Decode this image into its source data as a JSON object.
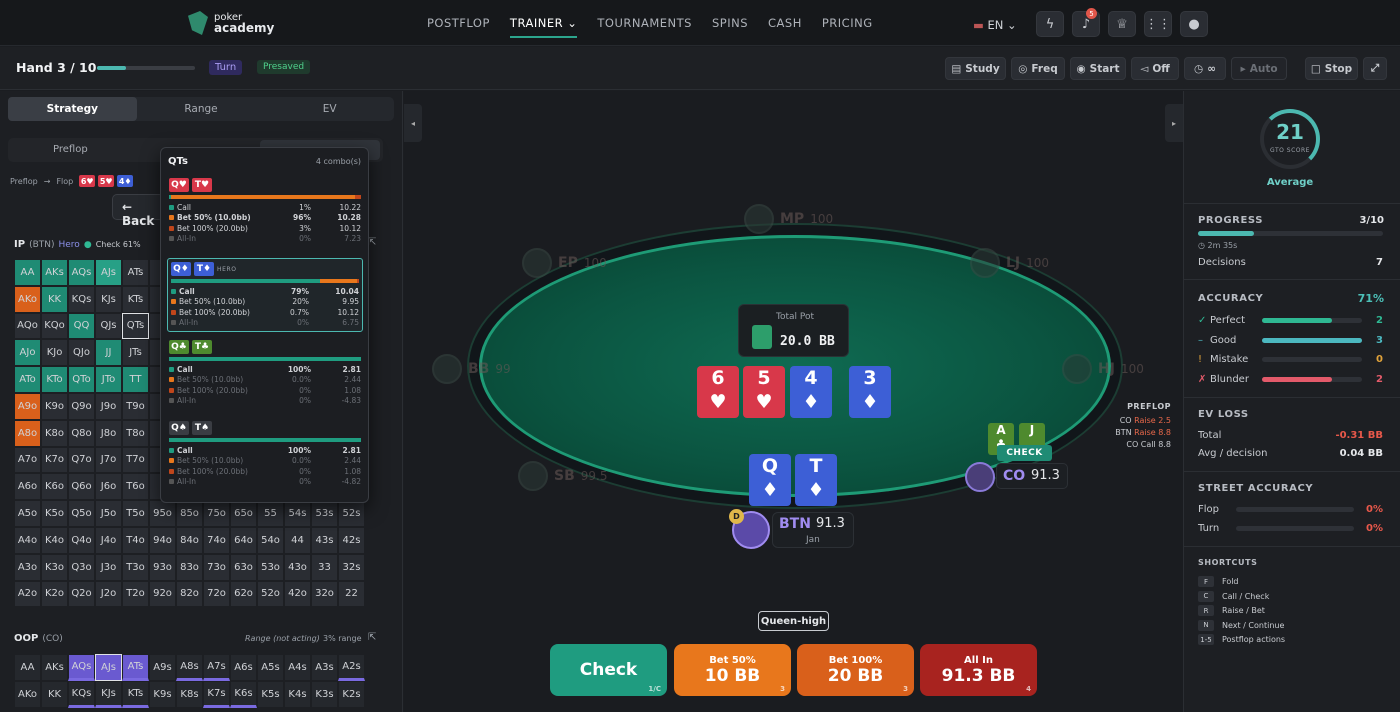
{
  "nav": {
    "brand_line1": "poker",
    "brand_line2": "academy",
    "links": [
      "POSTFLOP",
      "TRAINER",
      "TOURNAMENTS",
      "SPINS",
      "CASH",
      "PRICING"
    ],
    "lang": "EN",
    "notif_count": "5"
  },
  "sub": {
    "hand": "Hand 3 / 10",
    "hand_progress": 0.3,
    "street": "Turn",
    "presaved": "Presaved",
    "buttons": [
      "Study",
      "Freq",
      "Start",
      "Off",
      "∞",
      "Auto",
      "Stop"
    ]
  },
  "left": {
    "tabs": [
      "Strategy",
      "Range",
      "EV"
    ],
    "subtabs": [
      "Preflop"
    ],
    "crumbs": [
      "Preflop",
      "Flop"
    ],
    "back": "← Back",
    "ip": {
      "pos": "IP",
      "paren": "(BTN)",
      "hero": "Hero",
      "check": "Check 61%"
    },
    "oop": {
      "pos": "OOP",
      "paren": "(CO)",
      "note": "Range (not acting)",
      "pct": "3% range"
    },
    "grid": [
      [
        "AA",
        "AKs",
        "AQs",
        "AJs",
        "ATs",
        "",
        "",
        "",
        "",
        "",
        "",
        "",
        ""
      ],
      [
        "AKo",
        "KK",
        "KQs",
        "KJs",
        "KTs",
        "",
        "",
        "",
        "",
        "",
        "",
        "",
        ""
      ],
      [
        "AQo",
        "KQo",
        "QQ",
        "QJs",
        "QTs",
        "",
        "",
        "",
        "",
        "",
        "",
        "",
        ""
      ],
      [
        "AJo",
        "KJo",
        "QJo",
        "JJ",
        "JTs",
        "",
        "",
        "",
        "",
        "",
        "",
        "",
        ""
      ],
      [
        "ATo",
        "KTo",
        "QTo",
        "JTo",
        "TT",
        "",
        "",
        "",
        "",
        "",
        "",
        "",
        ""
      ],
      [
        "A9o",
        "K9o",
        "Q9o",
        "J9o",
        "T9o",
        "",
        "",
        "",
        "",
        "",
        "",
        "",
        ""
      ],
      [
        "A8o",
        "K8o",
        "Q8o",
        "J8o",
        "T8o",
        "",
        "",
        "",
        "",
        "",
        "",
        "",
        ""
      ],
      [
        "A7o",
        "K7o",
        "Q7o",
        "J7o",
        "T7o",
        "",
        "",
        "",
        "",
        "",
        "",
        "",
        ""
      ],
      [
        "A6o",
        "K6o",
        "Q6o",
        "J6o",
        "T6o",
        "",
        "",
        "",
        "",
        "",
        "",
        "",
        ""
      ],
      [
        "A5o",
        "K5o",
        "Q5o",
        "J5o",
        "T5o",
        "95o",
        "85o",
        "75o",
        "65o",
        "55",
        "54s",
        "53s",
        "52s"
      ],
      [
        "A4o",
        "K4o",
        "Q4o",
        "J4o",
        "T4o",
        "94o",
        "84o",
        "74o",
        "64o",
        "54o",
        "44",
        "43s",
        "42s"
      ],
      [
        "A3o",
        "K3o",
        "Q3o",
        "J3o",
        "T3o",
        "93o",
        "83o",
        "73o",
        "63o",
        "53o",
        "43o",
        "33",
        "32s"
      ],
      [
        "A2o",
        "K2o",
        "Q2o",
        "J2o",
        "T2o",
        "92o",
        "82o",
        "72o",
        "62o",
        "52o",
        "42o",
        "32o",
        "22"
      ]
    ],
    "oopgrid": [
      [
        "AA",
        "AKs",
        "AQs",
        "AJs",
        "ATs",
        "A9s",
        "A8s",
        "A7s",
        "A6s",
        "A5s",
        "A4s",
        "A3s",
        "A2s"
      ],
      [
        "AKo",
        "KK",
        "KQs",
        "KJs",
        "KTs",
        "K9s",
        "K8s",
        "K7s",
        "K6s",
        "K5s",
        "K4s",
        "K3s",
        "K2s"
      ]
    ]
  },
  "popup": {
    "title": "QTs",
    "combos": "4 combo(s)",
    "hero": "HERO",
    "combos_list": [
      {
        "c1": "Q♥",
        "c2": "T♥",
        "color": "#d8384a",
        "rows": [
          [
            "Call",
            "1%",
            "10.22"
          ],
          [
            "Bet 50% (10.0bb)",
            "96%",
            "10.28"
          ],
          [
            "Bet 100% (20.0bb)",
            "3%",
            "10.12"
          ],
          [
            "All-In",
            "0%",
            "7.23"
          ]
        ],
        "mix": [
          0.01,
          0.96,
          0.03
        ]
      },
      {
        "c1": "Q♦",
        "c2": "T♦",
        "color": "#3d5fd6",
        "rows": [
          [
            "Call",
            "79%",
            "10.04"
          ],
          [
            "Bet 50% (10.0bb)",
            "20%",
            "9.95"
          ],
          [
            "Bet 100% (20.0bb)",
            "0.7%",
            "10.12"
          ],
          [
            "All-In",
            "0%",
            "6.75"
          ]
        ],
        "mix": [
          0.79,
          0.2,
          0.01
        ]
      },
      {
        "c1": "Q♣",
        "c2": "T♣",
        "color": "#4e8a2e",
        "rows": [
          [
            "Call",
            "100%",
            "2.81"
          ],
          [
            "Bet 50% (10.0bb)",
            "0.0%",
            "2.44"
          ],
          [
            "Bet 100% (20.0bb)",
            "0%",
            "1.08"
          ],
          [
            "All-In",
            "0%",
            "-4.83"
          ]
        ],
        "mix": [
          1,
          0,
          0
        ]
      },
      {
        "c1": "Q♠",
        "c2": "T♠",
        "color": "#3a3d43",
        "rows": [
          [
            "Call",
            "100%",
            "2.81"
          ],
          [
            "Bet 50% (10.0bb)",
            "0.0%",
            "2.44"
          ],
          [
            "Bet 100% (20.0bb)",
            "0%",
            "1.08"
          ],
          [
            "All-In",
            "0%",
            "-4.82"
          ]
        ],
        "mix": [
          1,
          0,
          0
        ]
      }
    ]
  },
  "table": {
    "pot_label": "Total Pot",
    "pot": "20.0 BB",
    "board": [
      {
        "r": "6",
        "s": "♥",
        "c": "#d8384a"
      },
      {
        "r": "5",
        "s": "♥",
        "c": "#d8384a"
      },
      {
        "r": "4",
        "s": "♦",
        "c": "#3d5fd6"
      },
      {
        "r": "3",
        "s": "♦",
        "c": "#3d5fd6"
      }
    ],
    "hero_cards": [
      {
        "r": "Q",
        "s": "♦"
      },
      {
        "r": "T",
        "s": "♦"
      }
    ],
    "seats": {
      "mp": [
        "MP",
        "100"
      ],
      "ep": [
        "EP",
        "100"
      ],
      "lj": [
        "LJ",
        "100"
      ],
      "bb": [
        "BB",
        "99"
      ],
      "hj": [
        "HJ",
        "100"
      ],
      "sb": [
        "SB",
        "99.5"
      ]
    },
    "btn": {
      "pos": "BTN",
      "stack": "91.3",
      "name": "Jan",
      "dealer": "D"
    },
    "co": {
      "pos": "CO",
      "stack": "91.3",
      "cards": [
        "A",
        "J"
      ],
      "action": "CHECK"
    },
    "history": {
      "title": "PREFLOP",
      "lines": [
        [
          "CO",
          "Raise 2.5"
        ],
        [
          "BTN",
          "Raise 8.8"
        ],
        [
          "CO",
          "Call 8.8"
        ]
      ]
    },
    "hand_desc": "Queen-high",
    "actions": [
      {
        "top": "",
        "main": "Check",
        "key": "1/C"
      },
      {
        "top": "Bet 50%",
        "main": "10 BB",
        "key": "3"
      },
      {
        "top": "Bet 100%",
        "main": "20 BB",
        "key": "3"
      },
      {
        "top": "All In",
        "main": "91.3 BB",
        "key": "4"
      }
    ]
  },
  "right": {
    "score": "21",
    "score_label": "GTO SCORE",
    "score_word": "Average",
    "progress": {
      "label": "PROGRESS",
      "value": "3/10",
      "time": "2m 35s",
      "decisions_label": "Decisions",
      "decisions": "7",
      "fraction": 0.3
    },
    "accuracy": {
      "label": "ACCURACY",
      "pct": "71%",
      "rows": [
        [
          "Perfect",
          "2",
          "#2fb893",
          0.7
        ],
        [
          "Good",
          "3",
          "#4cb8c0",
          1.0
        ],
        [
          "Mistake",
          "0",
          "#e0a23a",
          0
        ],
        [
          "Blunder",
          "2",
          "#e35a6a",
          0.7
        ]
      ]
    },
    "ev": {
      "label": "EV LOSS",
      "total_label": "Total",
      "total": "-0.31 BB",
      "avg_label": "Avg / decision",
      "avg": "0.04 BB"
    },
    "street": {
      "label": "STREET ACCURACY",
      "rows": [
        [
          "Flop",
          "0%"
        ],
        [
          "Turn",
          "0%"
        ]
      ]
    },
    "shortcuts": {
      "label": "SHORTCUTS",
      "rows": [
        [
          "F",
          "Fold"
        ],
        [
          "C",
          "Call / Check"
        ],
        [
          "R",
          "Raise / Bet"
        ],
        [
          "N",
          "Next / Continue"
        ],
        [
          "1-5",
          "Postflop actions"
        ]
      ]
    }
  }
}
